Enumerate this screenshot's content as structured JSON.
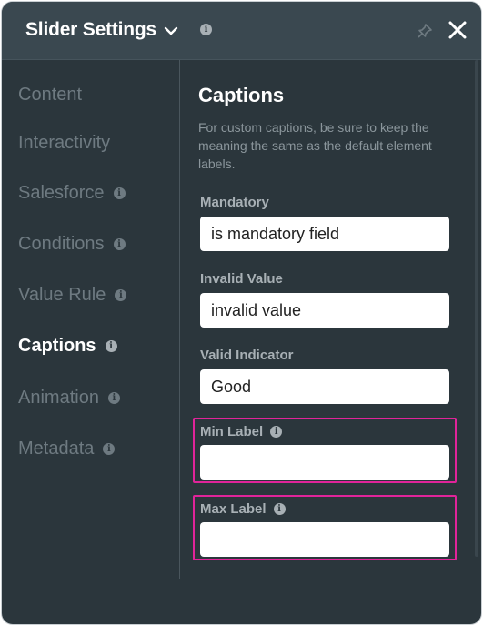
{
  "header": {
    "title": "Slider Settings",
    "info_icon": "info-icon",
    "pin_icon": "pin-icon",
    "close_icon": "close-icon"
  },
  "sidebar": {
    "items": [
      {
        "label": "Content",
        "has_info": false,
        "active": false
      },
      {
        "label": "Interactivity",
        "has_info": false,
        "active": false
      },
      {
        "label": "Salesforce",
        "has_info": true,
        "active": false
      },
      {
        "label": "Conditions",
        "has_info": true,
        "active": false
      },
      {
        "label": "Value Rule",
        "has_info": true,
        "active": false
      },
      {
        "label": "Captions",
        "has_info": true,
        "active": true
      },
      {
        "label": "Animation",
        "has_info": true,
        "active": false
      },
      {
        "label": "Metadata",
        "has_info": true,
        "active": false
      }
    ]
  },
  "main": {
    "title": "Captions",
    "description": "For custom captions, be sure to keep the meaning the same as the default element labels.",
    "fields": [
      {
        "label": "Mandatory",
        "value": "is mandatory field",
        "has_info": false
      },
      {
        "label": "Invalid Value",
        "value": "invalid value",
        "has_info": false
      },
      {
        "label": "Valid Indicator",
        "value": "Good",
        "has_info": false
      },
      {
        "label": "Min Label",
        "value": "",
        "has_info": true
      },
      {
        "label": "Max Label",
        "value": "",
        "has_info": true
      }
    ]
  },
  "colors": {
    "panel_bg": "#2b363c",
    "header_bg": "#3a4850",
    "highlight": "#e0249a"
  }
}
